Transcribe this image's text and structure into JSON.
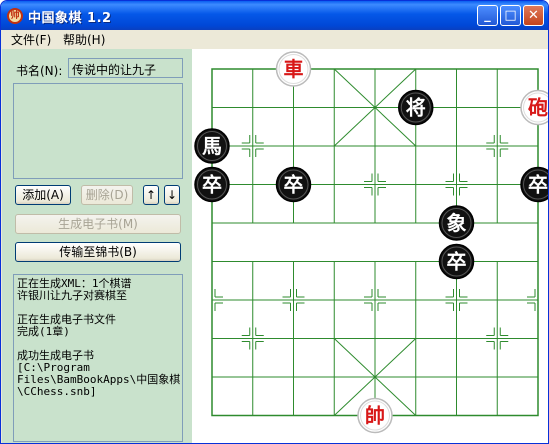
{
  "window": {
    "title": "中国象棋  1.2",
    "icon": "chess-app-icon",
    "controls": {
      "minimize": "_",
      "maximize": "□",
      "close": "✕"
    }
  },
  "menu": {
    "file": "文件(F)",
    "help": "帮助(H)"
  },
  "left_panel": {
    "book_name_label": "书名(N):",
    "book_name_value": "传说中的让九子",
    "chapter_list": [],
    "buttons": {
      "add": "添加(A)",
      "delete": "删除(D)",
      "up": "↑",
      "down": "↓",
      "generate": "生成电子书(M)",
      "transfer": "传输至锦书(B)"
    },
    "log_lines": [
      "正在生成XML：1个棋谱",
      "许银川让九子对赛棋至",
      "",
      "正在生成电子书文件",
      "完成(1章)",
      "",
      "成功生成电子书",
      "[C:\\Program",
      "Files\\BamBookApps\\中国象棋",
      "\\CChess.snb]"
    ]
  },
  "board": {
    "line_color": "#2e8b2e",
    "red_color": "#d81818",
    "black_color": "#000000",
    "pieces": [
      {
        "name": "chariot",
        "char": "車",
        "side": "red",
        "file": 2,
        "rank": 0
      },
      {
        "name": "general",
        "char": "将",
        "side": "black",
        "file": 5,
        "rank": 1
      },
      {
        "name": "cannon",
        "char": "砲",
        "side": "red",
        "file": 8,
        "rank": 1
      },
      {
        "name": "horse",
        "char": "馬",
        "side": "black",
        "file": 0,
        "rank": 2
      },
      {
        "name": "soldier",
        "char": "卒",
        "side": "black",
        "file": 0,
        "rank": 3
      },
      {
        "name": "soldier",
        "char": "卒",
        "side": "black",
        "file": 2,
        "rank": 3
      },
      {
        "name": "soldier",
        "char": "卒",
        "side": "black",
        "file": 8,
        "rank": 3
      },
      {
        "name": "elephant",
        "char": "象",
        "side": "black",
        "file": 6,
        "rank": 4
      },
      {
        "name": "soldier",
        "char": "卒",
        "side": "black",
        "file": 6,
        "rank": 5
      },
      {
        "name": "marshal",
        "char": "帥",
        "side": "red",
        "file": 4,
        "rank": 9
      }
    ]
  }
}
